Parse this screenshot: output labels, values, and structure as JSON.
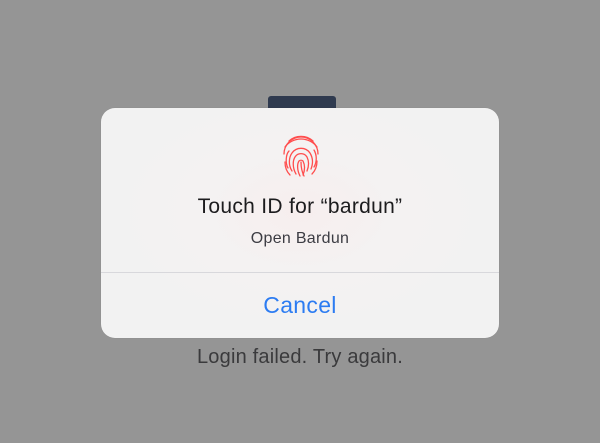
{
  "background": {
    "status_message": "Login failed. Try again."
  },
  "alert": {
    "icon": "fingerprint-icon",
    "title": "Touch ID for “bardun”",
    "message": "Open Bardun",
    "cancel_label": "Cancel"
  },
  "colors": {
    "overlay": "#959595",
    "alert_background": "#f2f2f2",
    "accent": "#2c7cf2",
    "fingerprint": "#ff4d4d"
  }
}
